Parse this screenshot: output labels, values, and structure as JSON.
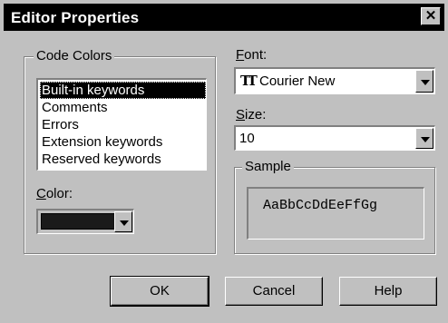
{
  "window": {
    "title": "Editor Properties",
    "close_glyph": "✕"
  },
  "code_colors": {
    "label": "Code Colors",
    "items": [
      "Built-in keywords",
      "Comments",
      "Errors",
      "Extension keywords",
      "Reserved keywords"
    ],
    "selected_index": 0,
    "color_label_accel": "C",
    "color_label_rest": "olor:",
    "color_value": "#1a1a1a"
  },
  "font": {
    "label_accel": "F",
    "label_rest": "ont:",
    "value": "Courier New",
    "icon": "truetype-icon"
  },
  "size": {
    "label_accel": "S",
    "label_rest": "ize:",
    "value": "10"
  },
  "sample": {
    "label": "Sample",
    "text": "AaBbCcDdEeFfGg"
  },
  "buttons": {
    "ok": "OK",
    "cancel": "Cancel",
    "help": "Help"
  }
}
